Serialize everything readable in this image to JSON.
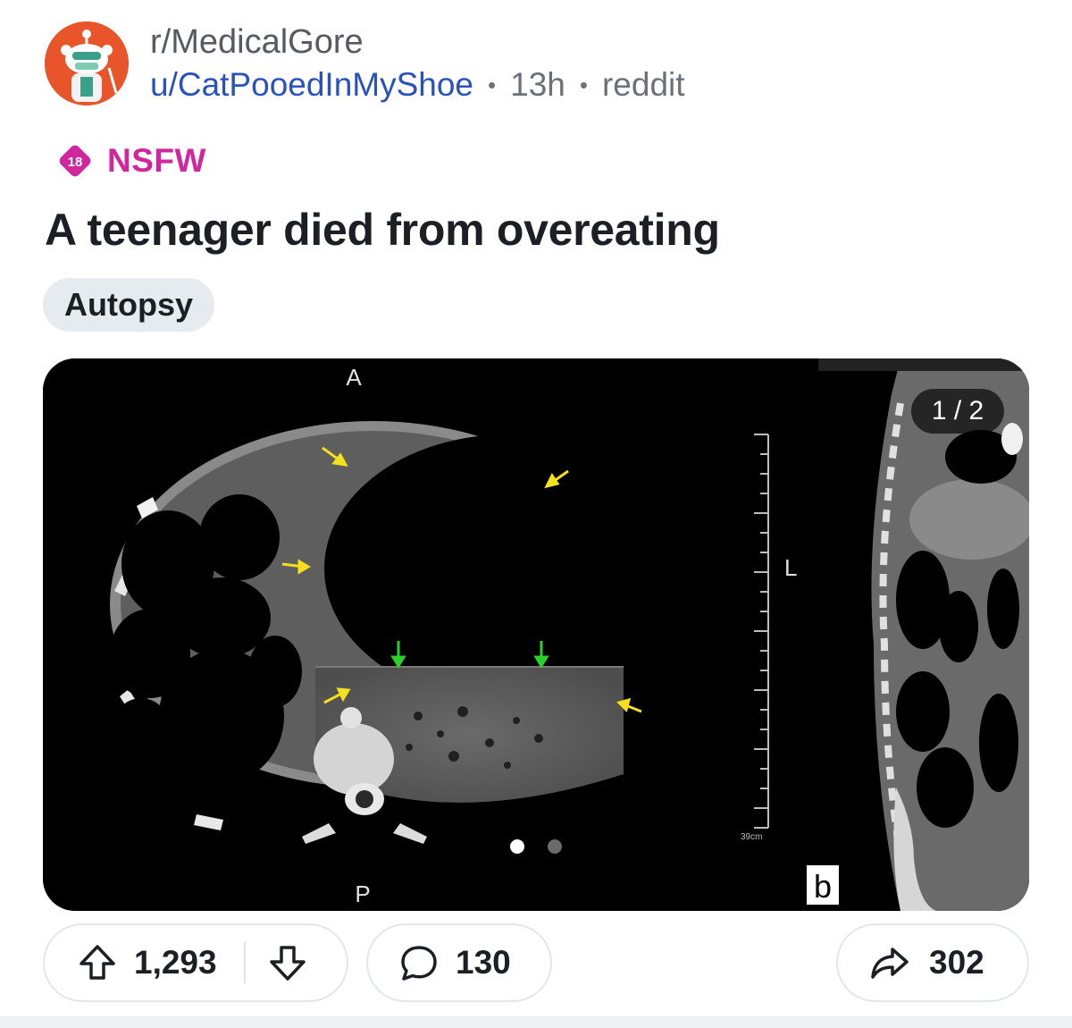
{
  "post": {
    "subreddit": "r/MedicalGore",
    "username": "u/CatPooedInMyShoe",
    "time": "13h",
    "source": "reddit",
    "nsfw_age": "18",
    "nsfw_label": "NSFW",
    "title": "A teenager died from overeating",
    "flair": "Autopsy"
  },
  "media": {
    "counter": "1 / 2",
    "current_index": 1,
    "total": 2,
    "scan_labels": {
      "anterior": "A",
      "posterior": "P",
      "left": "L",
      "scale": "39cm",
      "panel": "b"
    }
  },
  "actions": {
    "upvotes": "1,293",
    "comments": "130",
    "shares": "302"
  },
  "icons": {
    "upvote": "upvote-arrow-icon",
    "downvote": "downvote-arrow-icon",
    "comment": "comment-bubble-icon",
    "share": "share-arrow-icon",
    "nsfw": "nsfw-diamond-icon"
  },
  "colors": {
    "accent_user": "#2a52be",
    "nsfw": "#d1279e",
    "avatar_bg": "#e8552b",
    "flair_bg": "#e5ebee"
  }
}
